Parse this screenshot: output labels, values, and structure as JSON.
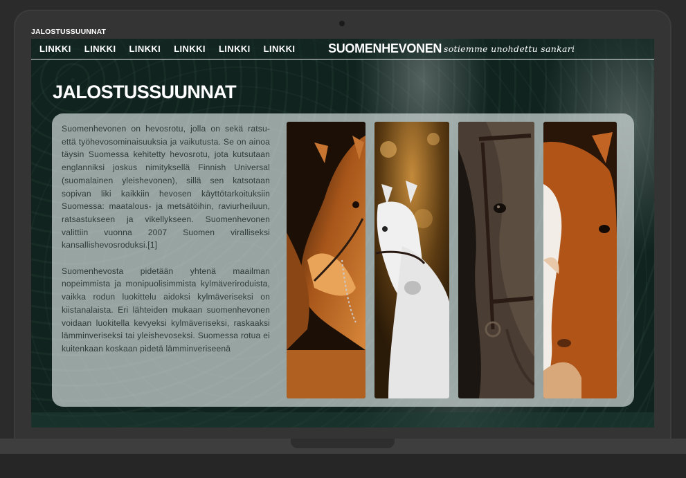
{
  "tab": {
    "title": "JALOSTUSSUUNNAT"
  },
  "nav": {
    "links": [
      "LINKKI",
      "LINKKI",
      "LINKKI",
      "LINKKI",
      "LINKKI",
      "LINKKI"
    ],
    "brand": "SUOMENHEVONEN",
    "tagline": "sotiemme unohdettu sankari"
  },
  "main": {
    "title": "JALOSTUSSUUNNAT",
    "paragraphs": [
      "Suomenhevonen on hevosrotu, jolla on sekä ratsu- että työhevosominaisuuksia ja vaikutusta. Se on ainoa täysin Suomessa kehitetty hevosrotu, jota kutsutaan englanniksi joskus nimityksellä Finnish Universal (suomalainen yleishevonen), sillä sen katsotaan sopivan liki kaikkiin hevosen käyttötarkoituksiin Suomessa: maatalous- ja metsätöihin, raviurheiluun, ratsastukseen ja vikellykseen. Suomenhevonen valittiin vuonna 2007 Suomen viralliseksi kansallishevosroduksi.[1]",
      "Suomenhevosta pidetään yhtenä maailman nopeimmista ja monipuolisimmista kylmäveriroduista, vaikka rodun luokittelu aidoksi kylmäveriseksi on kiistanalaista. Eri lähteiden mukaan suomenhevonen voidaan luokitella kevyeksi kylmäveriseksi, raskaaksi lämminveriseksi tai yleishevoseksi. Suomessa rotua ei kuitenkaan koskaan pidetä lämminveriseenä"
    ],
    "photos": [
      {
        "icon": "chestnut-horse-photo",
        "colors": [
          "#3a1f0d",
          "#b8641f",
          "#e8a050"
        ]
      },
      {
        "icon": "white-horse-photo",
        "colors": [
          "#5a3a12",
          "#cfcfcf",
          "#f2f2f2"
        ]
      },
      {
        "icon": "dark-horse-photo",
        "colors": [
          "#1a1410",
          "#4a3c32",
          "#6a5a4c"
        ]
      },
      {
        "icon": "blaze-horse-photo",
        "colors": [
          "#2a1608",
          "#b85a1c",
          "#f0ebe4"
        ]
      }
    ]
  },
  "colors": {
    "background": "#10231e",
    "card": "#cdd7d5",
    "text": "#2f3b38",
    "heading": "#ffffff"
  }
}
